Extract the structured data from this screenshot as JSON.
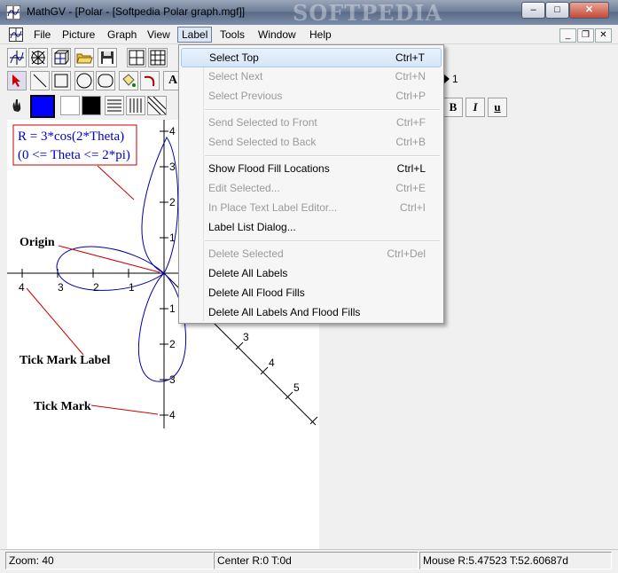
{
  "window": {
    "title": "MathGV - [Polar - [Softpedia Polar graph.mgf]]",
    "watermark": "SOFTPEDIA"
  },
  "menu": [
    "File",
    "Picture",
    "Graph",
    "View",
    "Label",
    "Tools",
    "Window",
    "Help"
  ],
  "label_menu": {
    "groups": [
      [
        {
          "label": "Select Top",
          "shortcut": "Ctrl+T",
          "enabled": true
        },
        {
          "label": "Select Next",
          "shortcut": "Ctrl+N",
          "enabled": false
        },
        {
          "label": "Select Previous",
          "shortcut": "Ctrl+P",
          "enabled": false
        }
      ],
      [
        {
          "label": "Send Selected to Front",
          "shortcut": "Ctrl+F",
          "enabled": false
        },
        {
          "label": "Send Selected to Back",
          "shortcut": "Ctrl+B",
          "enabled": false
        }
      ],
      [
        {
          "label": "Show Flood Fill Locations",
          "shortcut": "Ctrl+L",
          "enabled": true
        },
        {
          "label": "Edit Selected...",
          "shortcut": "Ctrl+E",
          "enabled": false
        },
        {
          "label": "In Place Text Label Editor...",
          "shortcut": "Ctrl+I",
          "enabled": false
        },
        {
          "label": "Label List Dialog...",
          "shortcut": "",
          "enabled": true
        }
      ],
      [
        {
          "label": "Delete Selected",
          "shortcut": "Ctrl+Del",
          "enabled": false
        },
        {
          "label": "Delete All Labels",
          "shortcut": "",
          "enabled": true
        },
        {
          "label": "Delete All Flood Fills",
          "shortcut": "",
          "enabled": true
        },
        {
          "label": "Delete All Labels And Flood Fills",
          "shortcut": "",
          "enabled": true
        }
      ]
    ]
  },
  "toolbar": {
    "line_width_value": "1",
    "bold": "B",
    "italic": "I",
    "underline": "u",
    "text_tool": "A"
  },
  "graph": {
    "equation_line1": "R = 3*cos(2*Theta)",
    "equation_line2": "(0 <= Theta <= 2*pi)",
    "annotations": {
      "origin": "Origin",
      "tick_mark_label": "Tick Mark Label",
      "tick_mark": "Tick Mark"
    },
    "x_ticks": [
      "4",
      "3",
      "2",
      "1"
    ],
    "y_ticks_up": [
      "4",
      "3",
      "2",
      "1"
    ],
    "y_ticks_down": [
      "1",
      "2",
      "3",
      "4"
    ],
    "diag_ticks": [
      "3",
      "4",
      "5"
    ],
    "colors": {
      "curve": "#0000aa",
      "equation_text": "#0000cc",
      "pointer_lines": "#cc0000"
    }
  },
  "status": {
    "zoom": "Zoom: 40",
    "center": "Center R:0 T:0d",
    "mouse": "Mouse R:5.47523 T:52.60687d"
  }
}
